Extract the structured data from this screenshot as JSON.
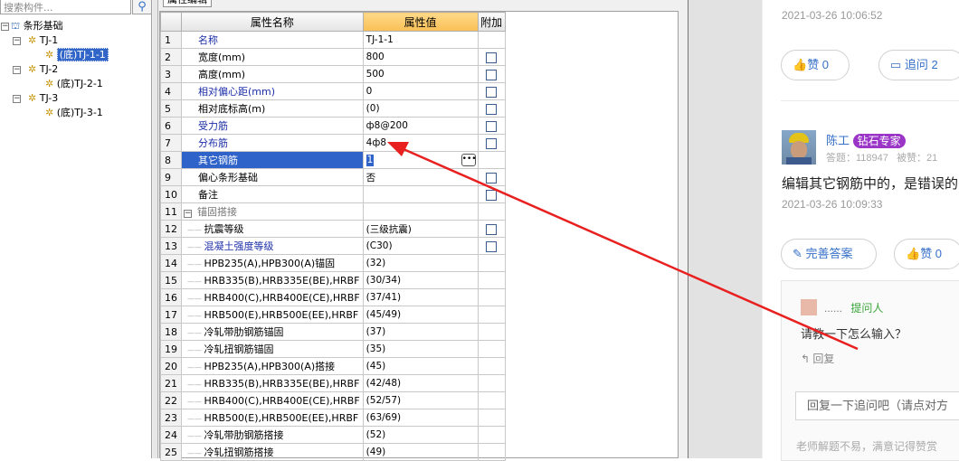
{
  "tree": {
    "search_placeholder": "搜索构件...",
    "search_icon": "search-icon",
    "root": "条形基础",
    "nodes": [
      {
        "label": "TJ-1",
        "child": "(底)TJ-1-1"
      },
      {
        "label": "TJ-2",
        "child": "(底)TJ-2-1"
      },
      {
        "label": "TJ-3",
        "child": "(底)TJ-3-1"
      }
    ]
  },
  "editor": {
    "tab": "属性编辑",
    "headers": {
      "num": "",
      "name": "属性名称",
      "value": "属性值",
      "extra": "附加"
    },
    "rows": [
      {
        "n": "1",
        "name": "名称",
        "value": "TJ-1-1",
        "cb": false,
        "style": "blue"
      },
      {
        "n": "2",
        "name": "宽度(mm)",
        "value": "800",
        "cb": true,
        "style": ""
      },
      {
        "n": "3",
        "name": "高度(mm)",
        "value": "500",
        "cb": true,
        "style": ""
      },
      {
        "n": "4",
        "name": "相对偏心距(mm)",
        "value": "0",
        "cb": true,
        "style": "blue"
      },
      {
        "n": "5",
        "name": "相对底标高(m)",
        "value": "(0)",
        "cb": true,
        "style": ""
      },
      {
        "n": "6",
        "name": "受力筋",
        "value": "ф8@200",
        "cb": true,
        "style": "blue"
      },
      {
        "n": "7",
        "name": "分布筋",
        "value": "4ф8",
        "cb": true,
        "style": "blue"
      },
      {
        "n": "8",
        "name": "其它钢筋",
        "value": "1",
        "cb": false,
        "style": "sel"
      },
      {
        "n": "9",
        "name": "偏心条形基础",
        "value": "否",
        "cb": true,
        "style": ""
      },
      {
        "n": "10",
        "name": "备注",
        "value": "",
        "cb": true,
        "style": ""
      },
      {
        "n": "11",
        "name": "锚固搭接",
        "value": "",
        "cb": false,
        "style": "group"
      },
      {
        "n": "12",
        "name": "抗震等级",
        "value": "(三级抗震)",
        "cb": true,
        "style": "ind"
      },
      {
        "n": "13",
        "name": "混凝土强度等级",
        "value": "(C30)",
        "cb": true,
        "style": "indblue"
      },
      {
        "n": "14",
        "name": "HPB235(A),HPB300(A)锚固",
        "value": "(32)",
        "cb": false,
        "style": "ind"
      },
      {
        "n": "15",
        "name": "HRB335(B),HRB335E(BE),HRBF",
        "value": "(30/34)",
        "cb": false,
        "style": "ind"
      },
      {
        "n": "16",
        "name": "HRB400(C),HRB400E(CE),HRBF",
        "value": "(37/41)",
        "cb": false,
        "style": "ind"
      },
      {
        "n": "17",
        "name": "HRB500(E),HRB500E(EE),HRBF",
        "value": "(45/49)",
        "cb": false,
        "style": "ind"
      },
      {
        "n": "18",
        "name": "冷轧带肋钢筋锚固",
        "value": "(37)",
        "cb": false,
        "style": "ind"
      },
      {
        "n": "19",
        "name": "冷轧扭钢筋锚固",
        "value": "(35)",
        "cb": false,
        "style": "ind"
      },
      {
        "n": "20",
        "name": "HPB235(A),HPB300(A)搭接",
        "value": "(45)",
        "cb": false,
        "style": "ind"
      },
      {
        "n": "21",
        "name": "HRB335(B),HRB335E(BE),HRBF",
        "value": "(42/48)",
        "cb": false,
        "style": "ind"
      },
      {
        "n": "22",
        "name": "HRB400(C),HRB400E(CE),HRBF",
        "value": "(52/57)",
        "cb": false,
        "style": "ind"
      },
      {
        "n": "23",
        "name": "HRB500(E),HRB500E(EE),HRBF",
        "value": "(63/69)",
        "cb": false,
        "style": "ind"
      },
      {
        "n": "24",
        "name": "冷轧带肋钢筋搭接",
        "value": "(52)",
        "cb": false,
        "style": "ind"
      },
      {
        "n": "25",
        "name": "冷轧扭钢筋搭接",
        "value": "(49)",
        "cb": false,
        "style": "ind"
      }
    ]
  },
  "qa": {
    "ts1": "2021-03-26 10:06:52",
    "like1": "赞 0",
    "followup1": "追问 2",
    "answerer": "陈工",
    "answerer_badge": "钻石专家",
    "answer_stats": "答题：118947",
    "answer_stats2": "被赞：21",
    "answer_text": "编辑其它钢筋中的，是错误的",
    "ts2": "2021-03-26 10:09:33",
    "improve_btn": "完善答案",
    "like2": "赞 0",
    "comment_user": "......",
    "comment_role": "提问人",
    "comment_text": "请教一下怎么输入？",
    "reply_label": "回复",
    "reply_placeholder": "回复一下追问吧（请点对方",
    "footer_text": "老师解题不易，满意记得赞赏"
  },
  "colors": {
    "accent": "#3670c8",
    "selection": "#2f63c9",
    "arrow": "#e82020",
    "badge": "#9b35c8"
  }
}
